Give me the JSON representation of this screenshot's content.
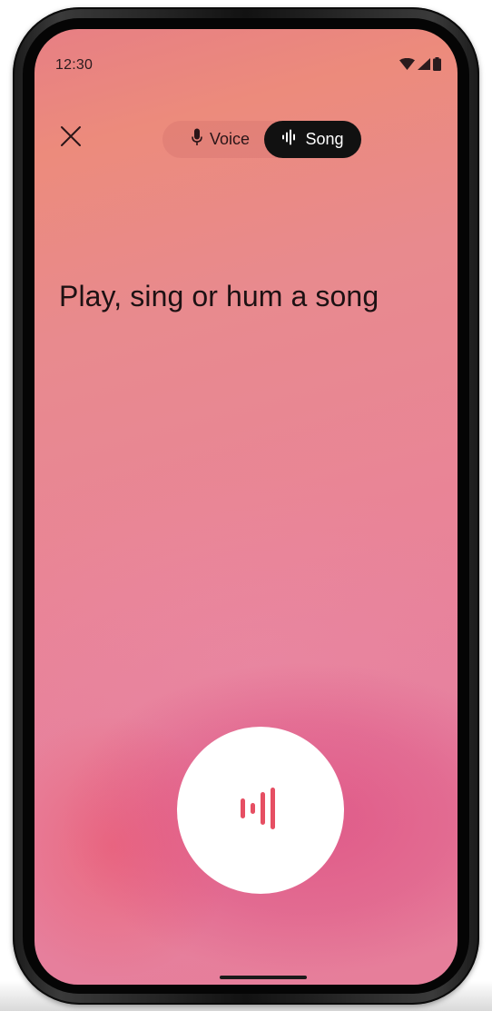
{
  "status_bar": {
    "time": "12:30",
    "icons": [
      "wifi-icon",
      "cellular-signal-icon",
      "battery-icon"
    ]
  },
  "top_bar": {
    "close_icon": "close-icon",
    "modes": [
      {
        "label": "Voice",
        "icon": "microphone-icon",
        "selected": false
      },
      {
        "label": "Song",
        "icon": "sound-wave-icon",
        "selected": true
      }
    ]
  },
  "main": {
    "prompt": "Play, sing or hum a song"
  },
  "listen_button": {
    "icon": "sound-wave-icon"
  },
  "colors": {
    "accent": "#e64f63",
    "toggle_selected": "#111111",
    "background_top": "#ec8b7c",
    "background_bottom": "#e67e9a"
  }
}
